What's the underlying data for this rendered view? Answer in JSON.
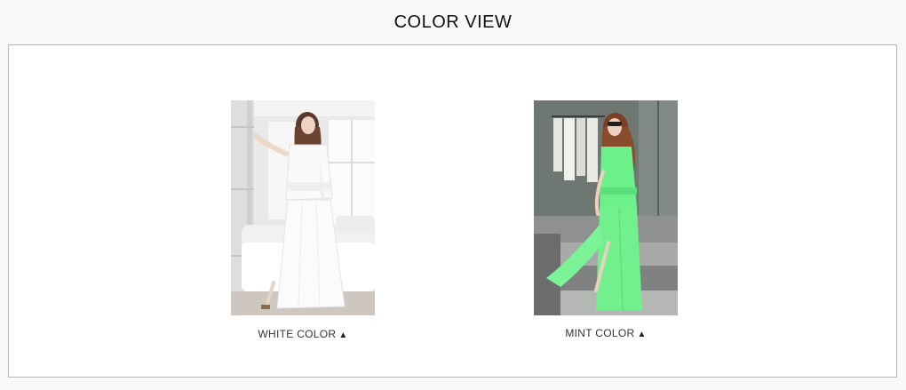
{
  "header": {
    "title": "COLOR VIEW"
  },
  "products": [
    {
      "caption": "WHITE COLOR",
      "marker": "▲",
      "accent": "#f2f2f0"
    },
    {
      "caption": "MINT COLOR",
      "marker": "▲",
      "accent": "#6cf089"
    }
  ]
}
